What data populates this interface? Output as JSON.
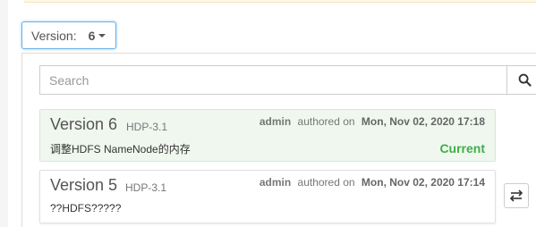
{
  "version_selector": {
    "label": "Version:",
    "value": "6"
  },
  "search": {
    "placeholder": "Search",
    "icon": "search-icon"
  },
  "versions": [
    {
      "title": "Version 6",
      "stack": "HDP-3.1",
      "author": "admin",
      "authored_on": "authored on",
      "date": "Mon, Nov 02, 2020 17:18",
      "note": "调整HDFS NameNode的内存",
      "status": "Current",
      "is_current": true
    },
    {
      "title": "Version 5",
      "stack": "HDP-3.1",
      "author": "admin",
      "authored_on": "authored on",
      "date": "Mon, Nov 02, 2020 17:14",
      "note": "??HDFS?????",
      "is_current": false,
      "action_icon": "compare-arrows-icon"
    }
  ],
  "colors": {
    "current_bg": "#f0f7ef",
    "current_status": "#3fae49",
    "focus_border": "#66afe9"
  }
}
